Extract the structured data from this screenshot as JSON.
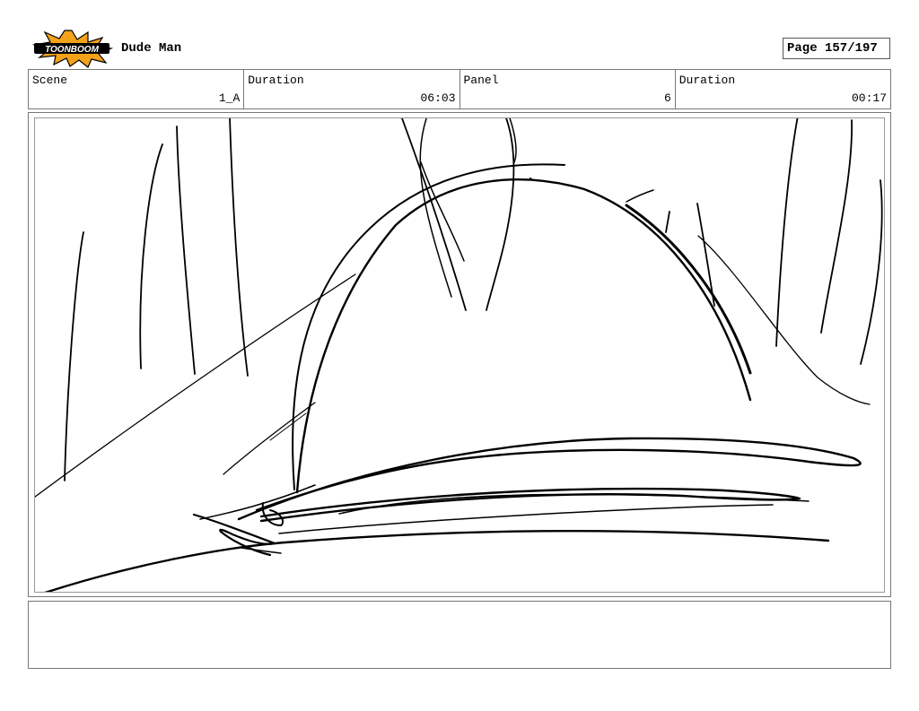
{
  "header": {
    "logo_text": "TOONBOOM",
    "project_title": "Dude Man",
    "page_label": "Page 157/197"
  },
  "info": {
    "scene_label": "Scene",
    "scene_value": "1_A",
    "scene_duration_label": "Duration",
    "scene_duration_value": "06:03",
    "panel_label": "Panel",
    "panel_value": "6",
    "panel_duration_label": "Duration",
    "panel_duration_value": "00:17"
  },
  "panel": {
    "content": "sketch"
  },
  "notes": {
    "text": ""
  },
  "colors": {
    "logo_orange": "#f5a21b",
    "ink": "#000000",
    "border": "#777777"
  }
}
